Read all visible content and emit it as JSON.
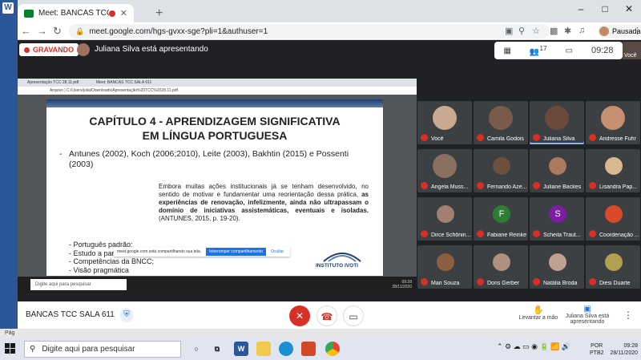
{
  "word": {
    "letter": "W",
    "status": "Pág"
  },
  "browser": {
    "tab_title": "Meet: BANCAS TCC SALA 611",
    "new_tab": "+",
    "url": "meet.google.com/hgs-gvxx-sge?pli=1&authuser=1",
    "profile_label": "Pausada",
    "window_controls": [
      "–",
      "□",
      "✕"
    ]
  },
  "meet": {
    "recording_label": "GRAVANDO",
    "presenting_text": "Juliana Silva está apresentando",
    "participant_count": "17",
    "time": "09:28",
    "self_label": "Você",
    "meeting_name": "BANCAS TCC SALA 611",
    "raise_hand_label": "Levantar a mão",
    "presenting_button_label": "Juliana Silva está apresentando"
  },
  "shared_screen": {
    "tab1": "Apresentação TCC 28.11.pdf",
    "tab2": "Meet: BANCAS TCC SALA 611",
    "address": "Arquivo | C:/Users/julia/Downloads/Apresentação%20TCC%2028.11.pdf",
    "slide": {
      "title_line1": "CAPÍTULO 4 - APRENDIZAGEM SIGNIFICATIVA",
      "title_line2": "EM LÍNGUA PORTUGUESA",
      "bullet1": "Antunes (2002), Koch (2006;2010), Leite (2003), Bakhtin (2015) e Possenti (2003)",
      "quote_normal": "Embora muitas ações institucionais já se tenham desenvolvido, no sentido de motivar e fundamentar uma reorientação dessa prática, ",
      "quote_bold": "as experiências de renovação, infelizmente, ainda não ultrapassam o domínio de iniciativas assistemáticas, eventuais e isoladas.",
      "quote_cite": " (ANTUNES, 2015, p. 19-20).",
      "list": [
        "-  Português padrão;",
        "-  Estudo a partir da ótica textual-interativa;",
        "-  Competências da BNCC;",
        "-  Visão pragmática"
      ],
      "logo_text": "INSTITUTO IVOTI"
    },
    "share_notice": "meet.google.com está compartilhando sua tela.",
    "stop_share": "Interromper compartilhamento",
    "hide": "Ocultar",
    "taskbar_search": "Digite aqui para pesquisar",
    "taskbar_time": "09:28",
    "taskbar_date": "28/11/2020"
  },
  "participants": [
    {
      "name": "Você",
      "color": "#c9a98f",
      "video": true
    },
    {
      "name": "Camila Godois",
      "color": "#7a5a4a",
      "video": true
    },
    {
      "name": "Juliana Silva",
      "color": "#6a4a3a",
      "video": true,
      "active": true
    },
    {
      "name": "Andresse Fuhr",
      "color": "#c59070",
      "video": true
    },
    {
      "name": "Angela Muss...",
      "color": "#8a7060",
      "video": true
    },
    {
      "name": "Fernando Aze...",
      "color": "#6b5040"
    },
    {
      "name": "Juliane Backes",
      "color": "#a87a60"
    },
    {
      "name": "Lisandra Pap...",
      "color": "#d8b890"
    },
    {
      "name": "Dirce Schönin...",
      "color": "#a08070"
    },
    {
      "name": "Fabiane Reinke",
      "letter": "F",
      "color": "#2e7d32"
    },
    {
      "name": "Scheila Traut...",
      "letter": "S",
      "color": "#7b1fa2"
    },
    {
      "name": "Coordenação ...",
      "color": "#d94a2a"
    },
    {
      "name": "Mari Souza",
      "color": "#8a6040"
    },
    {
      "name": "Doris Gerber",
      "color": "#b09080"
    },
    {
      "name": "Natália Broda",
      "color": "#c0a090"
    },
    {
      "name": "Diesi Duarte",
      "color": "#b0a050"
    }
  ],
  "taskbar": {
    "search_placeholder": "Digite aqui para pesquisar",
    "lang": "POR",
    "lang2": "PTB2",
    "time": "09:28",
    "date": "28/11/2020"
  }
}
